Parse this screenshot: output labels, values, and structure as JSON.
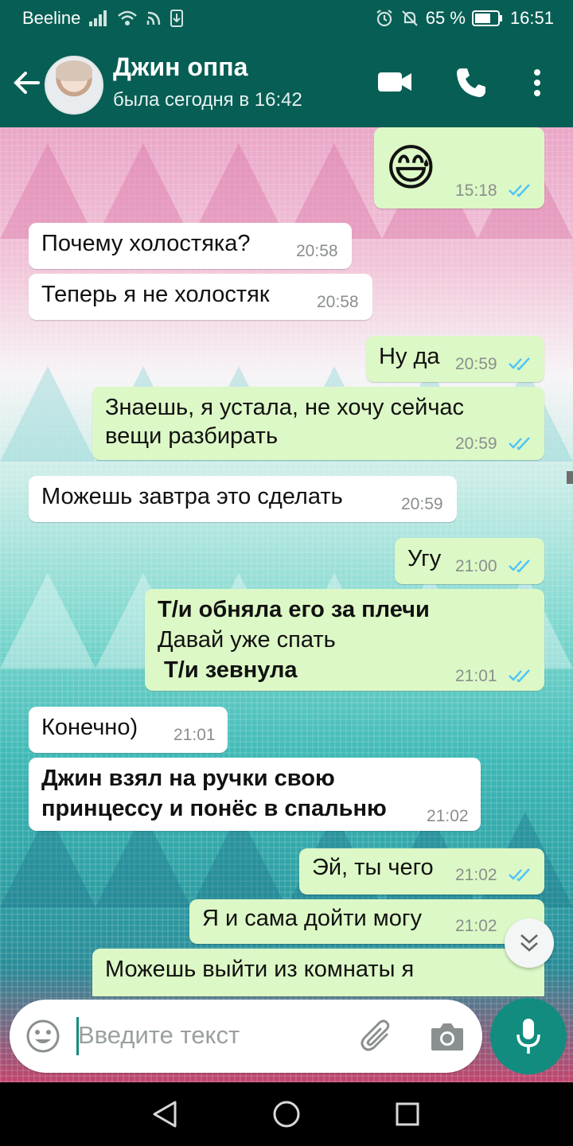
{
  "status_bar": {
    "carrier": "Beeline",
    "battery": "65 %",
    "time": "16:51"
  },
  "header": {
    "contact_name": "Джин оппа",
    "last_seen": "была сегодня в 16:42"
  },
  "messages": [
    {
      "dir": "out",
      "time": "15:18",
      "emoji": "😅",
      "ticks": "read"
    },
    {
      "dir": "in",
      "lines": [
        "Почему холостяка?"
      ],
      "time": "20:58"
    },
    {
      "dir": "in",
      "lines": [
        "Теперь я не холостяк"
      ],
      "time": "20:58"
    },
    {
      "dir": "out",
      "lines": [
        "Ну да"
      ],
      "time": "20:59",
      "ticks": "read"
    },
    {
      "dir": "out",
      "lines": [
        "Знаешь, я устала, не хочу сейчас",
        "вещи разбирать"
      ],
      "time": "20:59",
      "ticks": "read"
    },
    {
      "dir": "in",
      "lines": [
        "Можешь завтра это сделать"
      ],
      "time": "20:59"
    },
    {
      "dir": "out",
      "lines": [
        "Угу"
      ],
      "time": "21:00",
      "ticks": "read"
    },
    {
      "dir": "out",
      "lines": [
        "Т/и обняла его за плечи",
        "Давай уже спать",
        " Т/и зевнула"
      ],
      "time": "21:01",
      "ticks": "read"
    },
    {
      "dir": "in",
      "lines": [
        "Конечно)"
      ],
      "time": "21:01"
    },
    {
      "dir": "in",
      "lines": [
        "Джин взял на ручки свою",
        "принцессу и понёс в спальню"
      ],
      "time": "21:02"
    },
    {
      "dir": "out",
      "lines": [
        "Эй, ты чего"
      ],
      "time": "21:02",
      "ticks": "read"
    },
    {
      "dir": "out",
      "lines": [
        "Я и сама дойти могу"
      ],
      "time": "21:02",
      "ticks": "read"
    },
    {
      "dir": "out",
      "lines": [
        "Можешь выйти из комнаты я"
      ]
    }
  ],
  "composer": {
    "placeholder": "Введите текст"
  },
  "icons": {
    "back": "arrow-left-icon",
    "video": "video-call-icon",
    "call": "phone-icon",
    "menu": "more-vert-icon",
    "emoji": "emoji-icon",
    "attach": "paperclip-icon",
    "camera": "camera-icon",
    "mic": "mic-icon",
    "scroll_down": "chevron-double-down-icon"
  },
  "colors": {
    "header": "#075e54",
    "outgoing_bubble": "#dcf8c6",
    "incoming_bubble": "#ffffff",
    "accent": "#128c7e",
    "read_ticks": "#4fc3f7"
  }
}
